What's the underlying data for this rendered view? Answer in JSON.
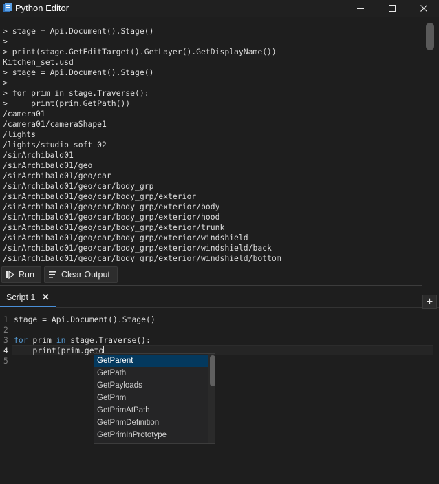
{
  "window": {
    "title": "Python Editor",
    "minimize_glyph": "—",
    "maximize_glyph": "☐",
    "close_glyph": "✕"
  },
  "output": {
    "lines": [
      "> stage = Api.Document().Stage()",
      ">",
      "> print(stage.GetEditTarget().GetLayer().GetDisplayName())",
      "Kitchen_set.usd",
      "> stage = Api.Document().Stage()",
      ">",
      "> for prim in stage.Traverse():",
      ">     print(prim.GetPath())",
      "/camera01",
      "/camera01/cameraShape1",
      "/lights",
      "/lights/studio_soft_02",
      "/sirArchibald01",
      "/sirArchibald01/geo",
      "/sirArchibald01/geo/car",
      "/sirArchibald01/geo/car/body_grp",
      "/sirArchibald01/geo/car/body_grp/exterior",
      "/sirArchibald01/geo/car/body_grp/exterior/body",
      "/sirArchibald01/geo/car/body_grp/exterior/hood",
      "/sirArchibald01/geo/car/body_grp/exterior/trunk",
      "/sirArchibald01/geo/car/body_grp/exterior/windshield",
      "/sirArchibald01/geo/car/body_grp/exterior/windshield/back",
      "/sirArchibald01/geo/car/body_grp/exterior/windshield/bottom"
    ]
  },
  "toolbar": {
    "run_label": "Run",
    "run_icon": "run-icon",
    "clear_label": "Clear Output",
    "clear_icon": "clear-output-icon"
  },
  "tabs": {
    "items": [
      {
        "label": "Script 1",
        "close_glyph": "✕"
      }
    ],
    "add_glyph": "+"
  },
  "editor": {
    "line_numbers": [
      "1",
      "2",
      "3",
      "4",
      "5"
    ],
    "current_line": "4",
    "line1": "stage = Api.Document().Stage()",
    "line3_kw_for": "for",
    "line3_a": " prim ",
    "line3_kw_in": "in",
    "line3_b": " stage.Traverse():",
    "line4": "    print(prim.geto"
  },
  "autocomplete": {
    "items": [
      "GetParent",
      "GetPath",
      "GetPayloads",
      "GetPrim",
      "GetPrimAtPath",
      "GetPrimDefinition",
      "GetPrimInPrototype"
    ],
    "selected": "GetParent"
  },
  "colors": {
    "background": "#1e1e1e",
    "keyword": "#569cd6",
    "accent": "#4a8fd8",
    "selection": "#04395e"
  }
}
